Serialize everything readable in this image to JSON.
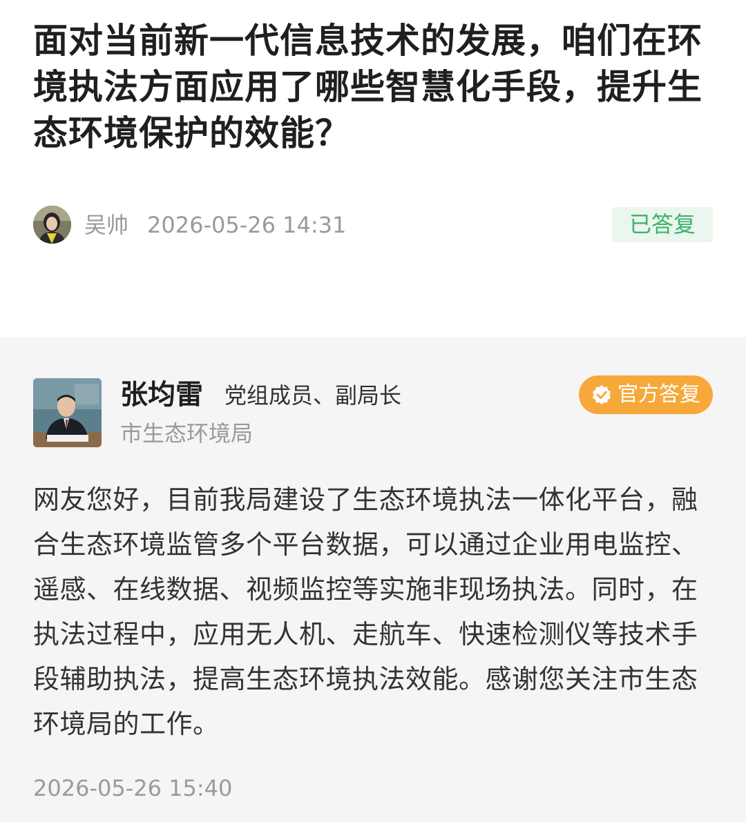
{
  "question": {
    "title": "面对当前新一代信息技术的发展，咱们在环境执法方面应用了哪些智慧化手段，提升生态环境保护的效能？",
    "asker_name": "吴帅",
    "timestamp": "2026-05-26 14:31",
    "status": "已答复",
    "status_color": "#3bb36a"
  },
  "answer": {
    "responder_name": "张均雷",
    "responder_role": "党组成员、副局长",
    "responder_org": "市生态环境局",
    "badge_label": "官方答复",
    "badge_color": "#f6a83a",
    "content": "网友您好，目前我局建设了生态环境执法一体化平台，融合生态环境监管多个平台数据，可以通过企业用电监控、遥感、在线数据、视频监控等实施非现场执法。同时，在执法过程中，应用无人机、走航车、快速检测仪等技术手段辅助执法，提高生态环境执法效能。感谢您关注市生态环境局的工作。",
    "timestamp": "2026-05-26 15:40"
  }
}
